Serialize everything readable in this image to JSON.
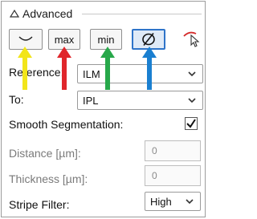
{
  "section": {
    "title": "Advanced"
  },
  "toolbar": {
    "max_label": "max",
    "min_label": "min"
  },
  "form": {
    "reference": {
      "label": "Reference:",
      "value": "ILM"
    },
    "to": {
      "label": "To:",
      "value": "IPL"
    },
    "smooth_segmentation": {
      "label": "Smooth Segmentation:",
      "checked": true
    },
    "distance": {
      "label": "Distance [µm]:",
      "value": "0"
    },
    "thickness": {
      "label": "Thickness [µm]:",
      "value": "0"
    },
    "stripe_filter": {
      "label": "Stripe Filter:",
      "value": "High"
    }
  },
  "colors": {
    "selected_border": "#2f74c9",
    "arrow_yellow": "#f2e51a",
    "arrow_red": "#e0262b",
    "arrow_green": "#27a84a",
    "arrow_blue": "#1a7fd0",
    "pointer_red": "#d42a2a"
  },
  "icons": {
    "collapse": "triangle-icon",
    "curve": "curve-icon",
    "empty_set": "empty-set-icon",
    "pointer": "pointer-icon",
    "caret": "chevron-down-icon",
    "check": "checkmark-icon"
  }
}
